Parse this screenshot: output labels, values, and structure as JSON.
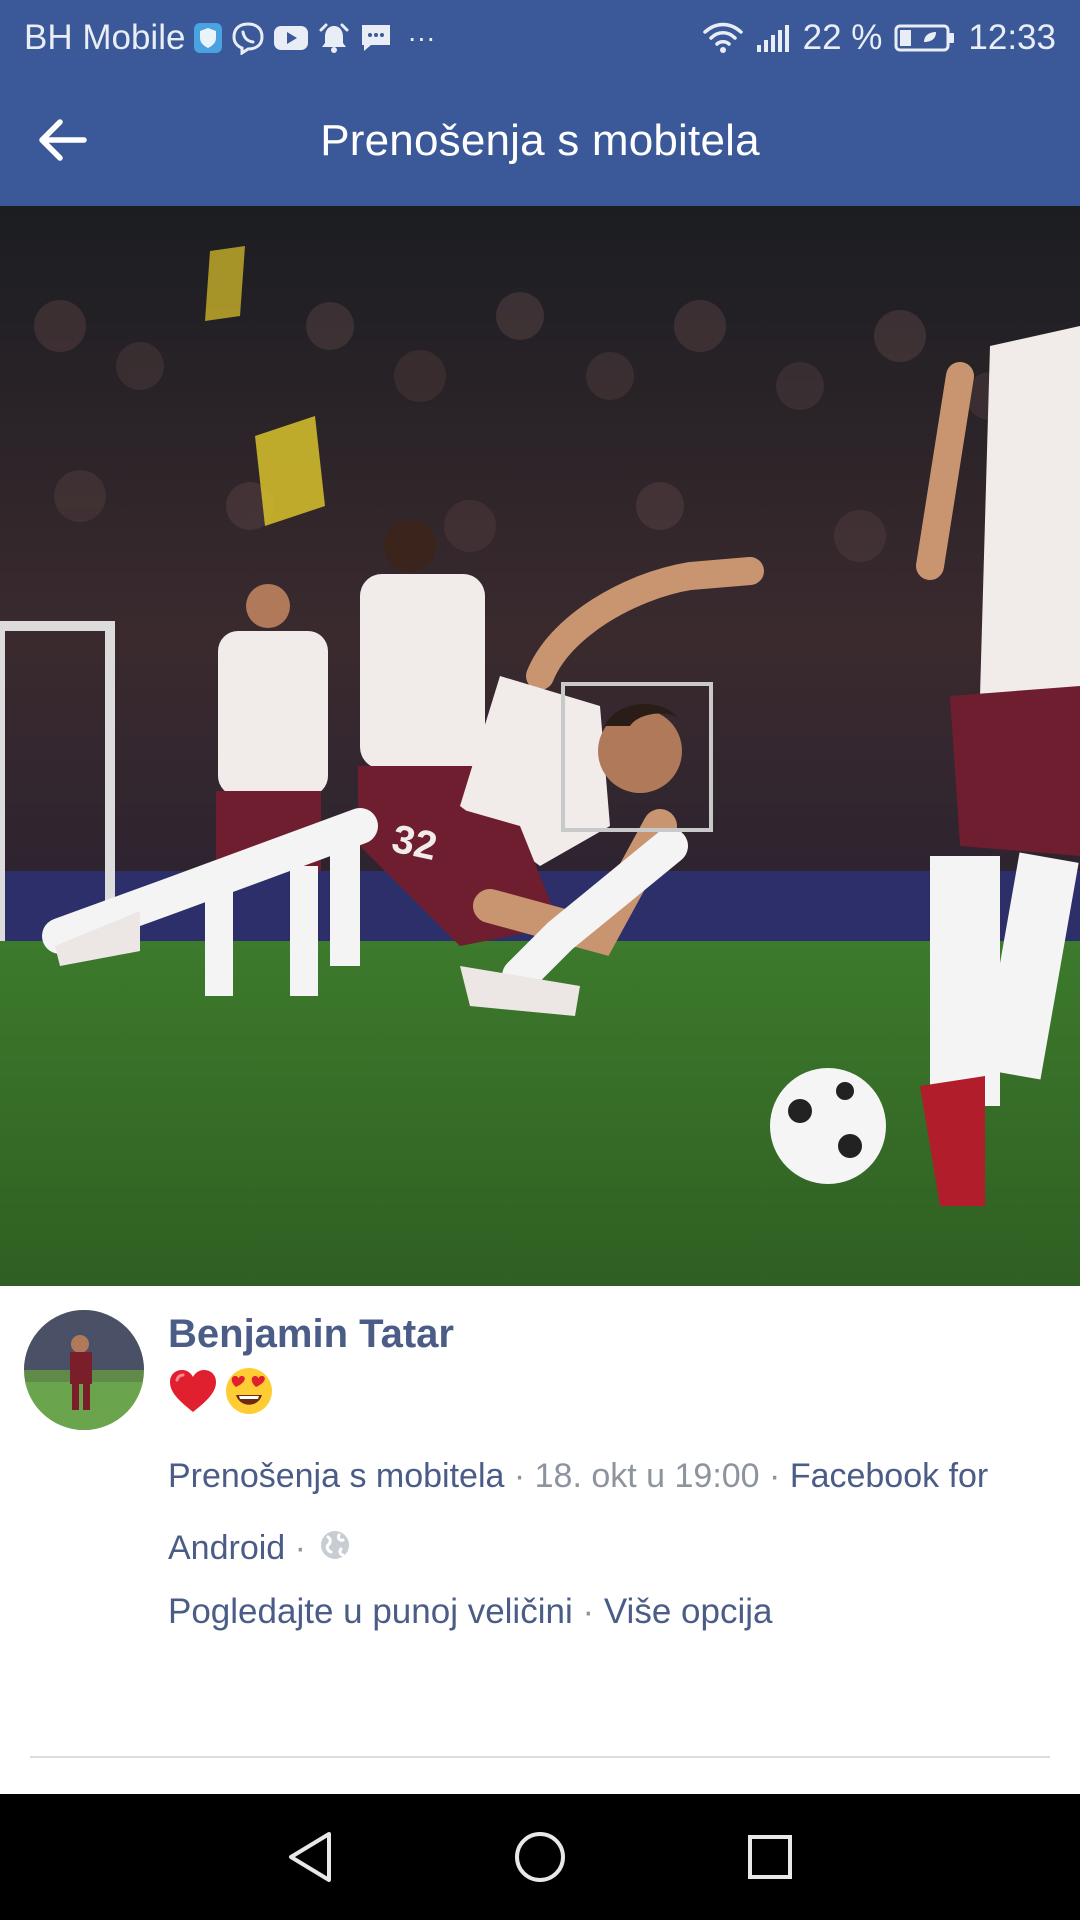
{
  "status_bar": {
    "carrier": "BH Mobile",
    "battery_percent": "22 %",
    "time": "12:33",
    "left_icons": [
      "shield-icon",
      "viber-icon",
      "youtube-icon",
      "alarm-icon",
      "message-icon",
      "more-icon"
    ],
    "right_icons": [
      "wifi-icon",
      "signal-icon",
      "battery-icon"
    ],
    "more_glyph": "···"
  },
  "app_bar": {
    "title": "Prenošenja s mobitela",
    "back_icon": "arrow-left-icon",
    "background": "#3b5998"
  },
  "photo": {
    "description_icon": "photo",
    "jersey_number": "32"
  },
  "post": {
    "author": "Benjamin Tatar",
    "caption_emojis": [
      "heart-emoji",
      "heart-eyes-emoji"
    ],
    "album": "Prenošenja s mobitela",
    "separator": " · ",
    "date": "18. okt u 19:00",
    "app_line1": "Facebook for",
    "app_line2": "Android",
    "privacy_icon": "globe-icon",
    "view_full": "Pogledajte u punoj veličini",
    "more_options": "Više opcija"
  },
  "nav_bar": {
    "back": "nav-back-icon",
    "home": "nav-home-icon",
    "recents": "nav-recents-icon"
  },
  "colors": {
    "brand": "#3b5998",
    "link": "#4b5c87",
    "muted": "#8d949e"
  }
}
